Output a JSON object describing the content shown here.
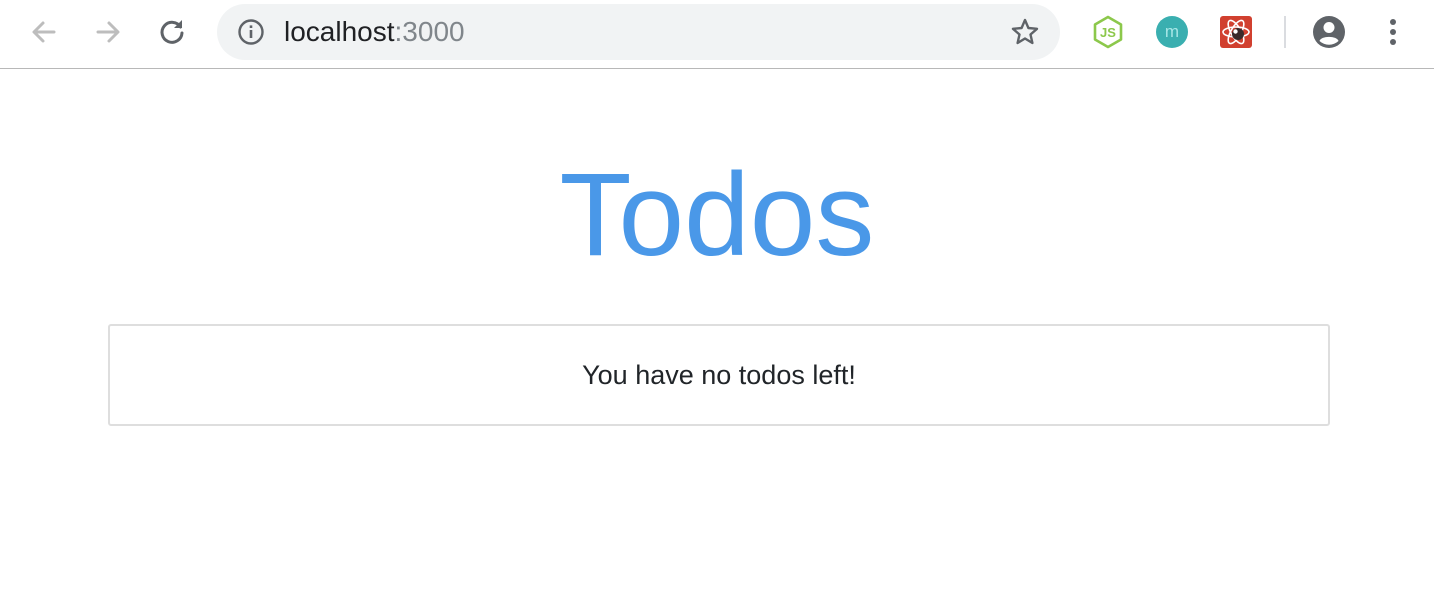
{
  "browser": {
    "url": {
      "host": "localhost",
      "port": ":3000"
    },
    "nav": {
      "back": "arrow-left-icon",
      "forward": "arrow-right-icon",
      "reload": "reload-icon"
    },
    "extensions": [
      "nodejs-extension-icon",
      "m-extension-icon",
      "react-devtools-extension-icon"
    ],
    "profile": "account-circle-icon",
    "menu": "more-vert-icon"
  },
  "app": {
    "title": "Todos",
    "empty_message": "You have no todos left!"
  },
  "colors": {
    "title": "#4a98e8",
    "omnibox_bg": "#f1f3f4",
    "panel_border": "#dedede",
    "icon_gray": "#5f6368",
    "icon_disabled": "#bdbdbd",
    "node_green": "#8cc84b",
    "m_teal": "#3aafb0",
    "react_red": "#d1402f"
  }
}
